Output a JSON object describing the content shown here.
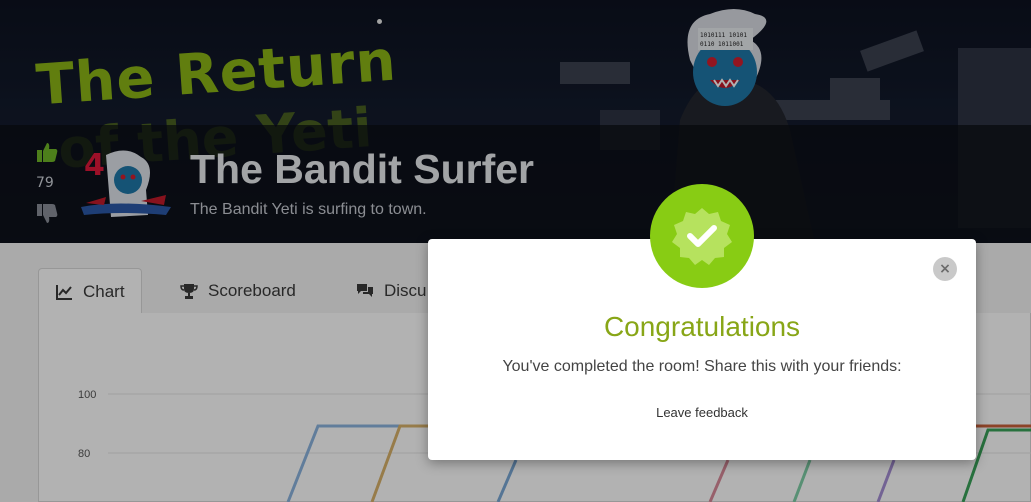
{
  "banner": {
    "art_title_line1": "The Return",
    "art_title_line2": "of the Yeti",
    "room_title": "The Bandit Surfer",
    "room_subtitle": "The Bandit Yeti is surfing to town.",
    "upvotes": "79",
    "badge_number": "4"
  },
  "tabs": [
    {
      "label": "Chart",
      "icon": "chart-icon"
    },
    {
      "label": "Scoreboard",
      "icon": "trophy-icon"
    },
    {
      "label": "Discu",
      "icon": "comments-icon"
    }
  ],
  "chart": {
    "y_ticks": [
      "100",
      "80"
    ],
    "line_colors": [
      "#8bb3de",
      "#d9b26a",
      "#7aa8d6",
      "#d98a9a",
      "#7fcfa6",
      "#a58fd4",
      "#3aa35a",
      "#c9603a"
    ]
  },
  "modal": {
    "title": "Congratulations",
    "message": "You've completed the room! Share this with your friends:",
    "feedback_link": "Leave feedback",
    "close_label": "×"
  },
  "colors": {
    "accent_green": "#88cc14",
    "title_green": "#88a617",
    "art_green": "#8bb516",
    "badge_red": "#e0183a"
  }
}
